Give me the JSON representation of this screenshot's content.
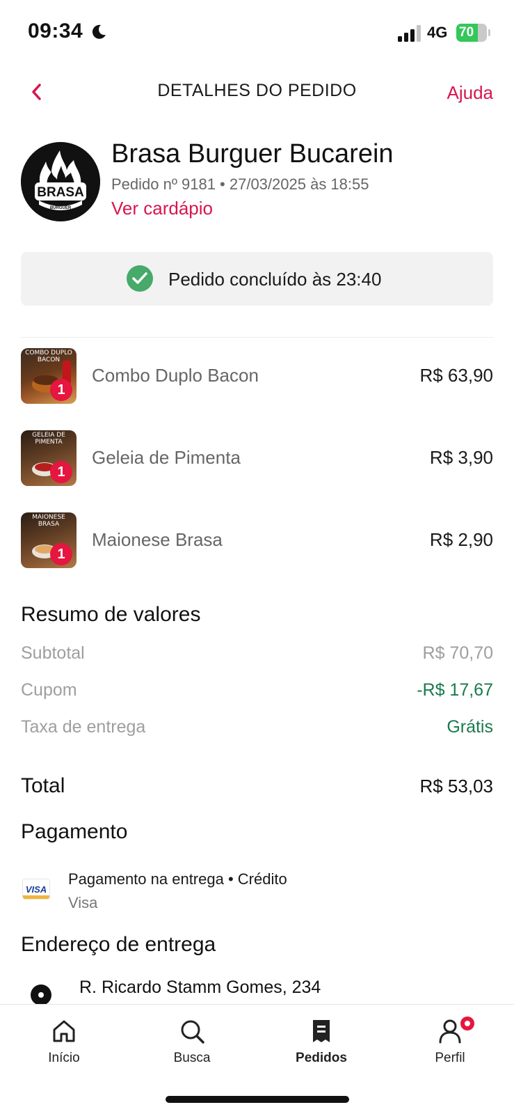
{
  "status_bar": {
    "time": "09:34",
    "network": "4G",
    "battery_percent": "70",
    "battery_level": 0.7
  },
  "header": {
    "title": "DETALHES DO PEDIDO",
    "help_label": "Ajuda"
  },
  "store": {
    "name": "Brasa Burguer Bucarein",
    "order_meta": "Pedido nº 9181 • 27/03/2025 às 18:55",
    "menu_link": "Ver cardápio",
    "logo_text": "BRASA BURGUER OFICIAL"
  },
  "order_status": {
    "text": "Pedido concluído às 23:40"
  },
  "items": [
    {
      "name": "Combo Duplo Bacon",
      "price": "R$ 63,90",
      "qty": "1",
      "thumb_caption": "COMBO DUPLO BACON"
    },
    {
      "name": "Geleia de Pimenta",
      "price": "R$ 3,90",
      "qty": "1",
      "thumb_caption": "GELEIA DE PIMENTA"
    },
    {
      "name": "Maionese Brasa",
      "price": "R$ 2,90",
      "qty": "1",
      "thumb_caption": "MAIONESE BRASA"
    }
  ],
  "summary": {
    "title": "Resumo de valores",
    "subtotal_label": "Subtotal",
    "subtotal_value": "R$ 70,70",
    "coupon_label": "Cupom",
    "coupon_value": "-R$ 17,67",
    "delivery_label": "Taxa de entrega",
    "delivery_value": "Grátis",
    "total_label": "Total",
    "total_value": "R$ 53,03"
  },
  "payment": {
    "title": "Pagamento",
    "method": "Pagamento na entrega • Crédito",
    "brand": "Visa",
    "card_logo_text": "VISA"
  },
  "address": {
    "title": "Endereço de entrega",
    "line1": "R. Ricardo Stamm Gomes, 234"
  },
  "tabs": [
    {
      "label": "Início",
      "icon": "home-icon"
    },
    {
      "label": "Busca",
      "icon": "search-icon"
    },
    {
      "label": "Pedidos",
      "icon": "orders-icon",
      "active": true
    },
    {
      "label": "Perfil",
      "icon": "profile-icon"
    }
  ],
  "colors": {
    "accent": "#d6164f",
    "success": "#47a96a",
    "discount": "#1a7a4c",
    "badge": "#e5163f"
  }
}
